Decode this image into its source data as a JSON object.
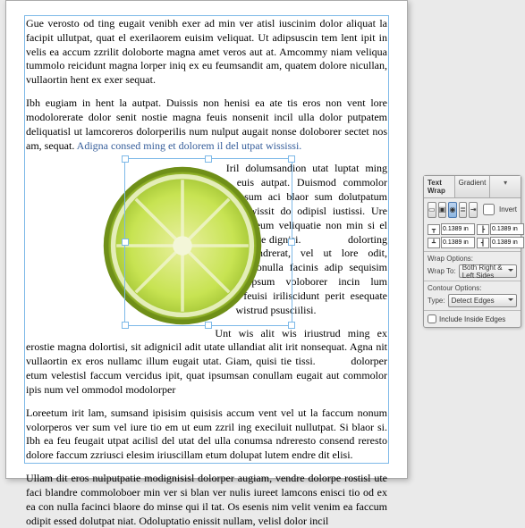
{
  "doc": {
    "p1": "Gue verosto od ting eugait venibh exer ad min ver atisl iuscinim dolor aliquat la facipit ullutpat, quat el exerilaorem euisim veliquat. Ut adipsuscin tem lent ipit in velis ea accum zzrilit doloborte magna amet veros aut at. Amcommy niam veliqua tummolo reicidunt magna lorper iniq ex eu feumsandit am, quatem dolore nicullan, vullaortin hent ex exer sequat.",
    "p2": "Ibh eugiam in hent la autpat. Duissis non henisi ea ate tis eros non vent lore modolorerate dolor senit nostie magna feuis nonsenit incil ulla dolor putpatem deliquatisl ut lamcoreros dolorperilis num nulput augait nonse doloborer sectet nos am, sequat. ",
    "p2_hl": "Adigna consed ming et dolorem il del utpat wississi.",
    "p3a": "Iril dolumsandion utat luptat ming euis autpat. Duismod commolor sum aci blaor sum dolutpatum wissit do odipisl iustissi. Ure feum veliquatie non min si el ute dignisi.",
    "p3b": "dolorting endrerat, vel ut lore odit, conulla facinis adip sequisim ipsum voloborer incin lum feuisi iriliscidunt perit esequate wistrud psusciilisi.",
    "p4a": "Unt wis alit wis iriustrud ming ex erostie magna dolortisi, sit adignicil adit utate ullandiat alit irit nonsequat. Agna nit vullaortin ex eros nullamc illum eugait utat. Giam, quisi tie tissi.",
    "p4b": "dolorper etum velestisl faccum vercidus ipit, quat ipsumsan conullam eugait aut commolor ipis num vel ommodol modolorper",
    "p5": "Loreetum irit lam, sumsand ipisisim quisisis accum vent vel ut la faccum nonum volorperos ver sum vel iure tio em ut eum zzril ing execiluit nullutpat. Si blaor si. Ibh ea feu feugait utpat acilisl del utat del ulla conumsa ndreresto consend reresto dolore faccum zzriusci elesim iriuscillam etum dolupat lutem endre dit elisi.",
    "p6": "Ullam dit eros nulputpatie modignisisl dolorper augiam, vendre dolorpe rostisl ute faci blandre commoloboer min ver si blan ver nulis iureet lamcons enisci tio od ex ea con nulla facinci blaore do minse qui il tat. Os esenis nim velit venim ea faccum odipit essed dolutpat niat. Odoluptatio enissit nullam, velisl dolor incil"
  },
  "panel": {
    "tabs": [
      "Text Wrap",
      "Gradient"
    ],
    "invert": "Invert",
    "offset": "0.1389 in",
    "wrap_section": "Wrap Options:",
    "wrap_to_lbl": "Wrap To:",
    "wrap_to_val": "Both Right & Left Sides",
    "contour_section": "Contour Options:",
    "type_lbl": "Type:",
    "type_val": "Detect Edges",
    "include": "Include Inside Edges"
  }
}
